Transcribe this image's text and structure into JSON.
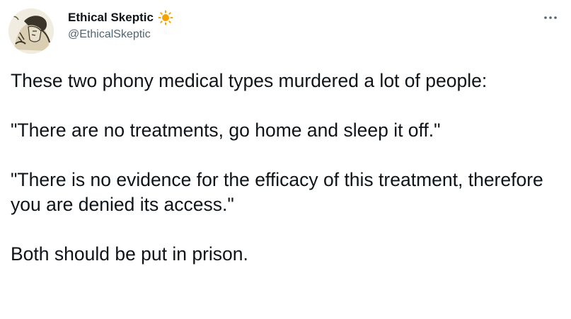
{
  "tweet": {
    "author": {
      "display_name": "Ethical Skeptic",
      "handle": "@EthicalSkeptic",
      "name_emoji": "sun-icon"
    },
    "more_menu": "more-options-icon",
    "paragraphs": [
      "These two phony medical types murdered a lot of people:",
      "\"There are no treatments, go home and sleep it off.\"",
      "\"There is no evidence for the efficacy of this treatment, therefore you are denied its access.\"",
      "Both should be put in prison."
    ]
  },
  "colors": {
    "text_primary": "#0f1419",
    "text_secondary": "#536471",
    "sun": "#f4a300"
  }
}
